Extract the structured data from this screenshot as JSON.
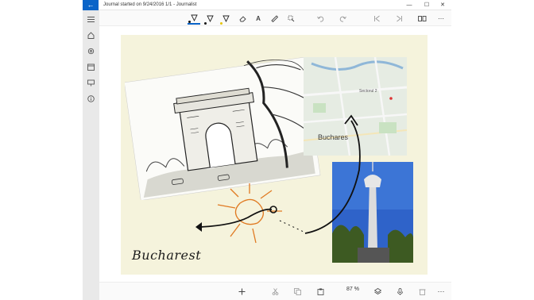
{
  "window": {
    "title": "Journal started on 9/24/2016 1/1 - Journalist",
    "controls": {
      "minimize": "—",
      "maximize": "☐",
      "close": "✕"
    }
  },
  "toolbar": {
    "tools": [
      {
        "name": "pen-black",
        "color": "#111111"
      },
      {
        "name": "pen-black-2",
        "color": "#111111"
      },
      {
        "name": "highlighter-yellow",
        "color": "#e6c400"
      },
      {
        "name": "eraser"
      },
      {
        "name": "text-tool",
        "glyph": "A"
      },
      {
        "name": "ruler"
      },
      {
        "name": "lasso"
      },
      {
        "name": "undo"
      },
      {
        "name": "redo"
      },
      {
        "name": "previous-page"
      },
      {
        "name": "next-page"
      },
      {
        "name": "page-view"
      },
      {
        "name": "more"
      }
    ],
    "more_label": "⋯"
  },
  "journal": {
    "map_label": "Buchares",
    "map_sector_label": "Sectorul 2",
    "caption": "Bucharest"
  },
  "bottombar": {
    "zoom": "87 %",
    "more_label": "⋯"
  },
  "colors": {
    "accent": "#0a64c8",
    "page": "#f5f3dc",
    "sun": "#e07a22",
    "sky": "#2f63c9"
  }
}
